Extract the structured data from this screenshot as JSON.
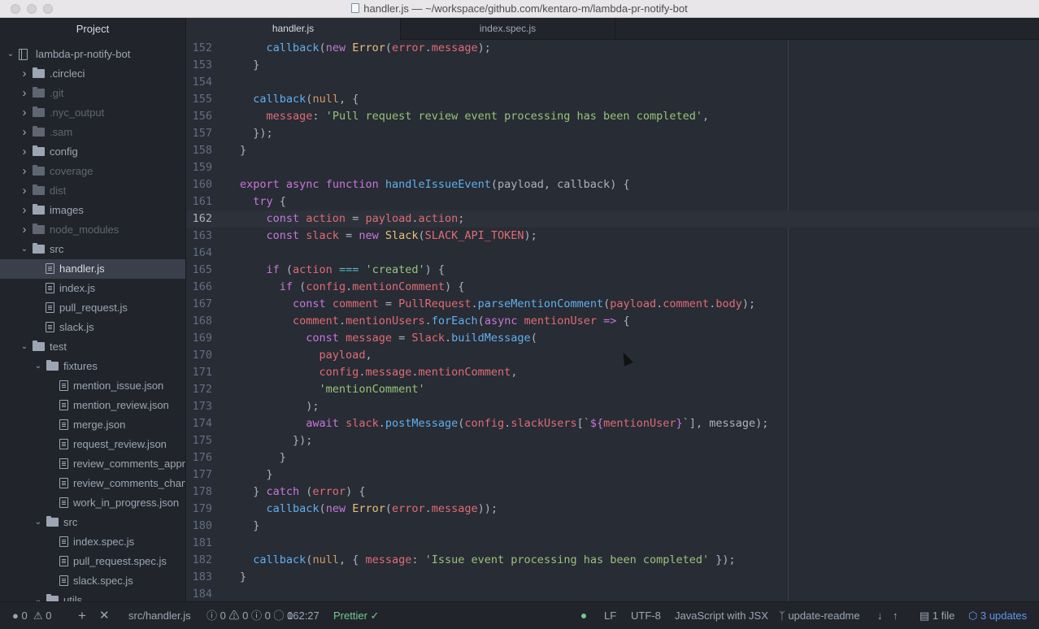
{
  "window": {
    "title": "handler.js — ~/workspace/github.com/kentaro-m/lambda-pr-notify-bot"
  },
  "sidebar": {
    "header": "Project",
    "tree": [
      {
        "label": "lambda-pr-notify-bot",
        "type": "repo",
        "depth": 0,
        "expanded": true,
        "dim": false
      },
      {
        "label": ".circleci",
        "type": "folder",
        "depth": 1,
        "expanded": false,
        "dim": false
      },
      {
        "label": ".git",
        "type": "folder",
        "depth": 1,
        "expanded": false,
        "dim": true
      },
      {
        "label": ".nyc_output",
        "type": "folder",
        "depth": 1,
        "expanded": false,
        "dim": true
      },
      {
        "label": ".sam",
        "type": "folder",
        "depth": 1,
        "expanded": false,
        "dim": true
      },
      {
        "label": "config",
        "type": "folder",
        "depth": 1,
        "expanded": false,
        "dim": false
      },
      {
        "label": "coverage",
        "type": "folder",
        "depth": 1,
        "expanded": false,
        "dim": true
      },
      {
        "label": "dist",
        "type": "folder",
        "depth": 1,
        "expanded": false,
        "dim": true
      },
      {
        "label": "images",
        "type": "folder",
        "depth": 1,
        "expanded": false,
        "dim": false
      },
      {
        "label": "node_modules",
        "type": "folder",
        "depth": 1,
        "expanded": false,
        "dim": true
      },
      {
        "label": "src",
        "type": "folder",
        "depth": 1,
        "expanded": true,
        "dim": false
      },
      {
        "label": "handler.js",
        "type": "file",
        "depth": 2,
        "selected": true
      },
      {
        "label": "index.js",
        "type": "file",
        "depth": 2
      },
      {
        "label": "pull_request.js",
        "type": "file",
        "depth": 2
      },
      {
        "label": "slack.js",
        "type": "file",
        "depth": 2
      },
      {
        "label": "test",
        "type": "folder",
        "depth": 1,
        "expanded": true,
        "dim": false
      },
      {
        "label": "fixtures",
        "type": "folder",
        "depth": 2,
        "expanded": true,
        "dim": false
      },
      {
        "label": "mention_issue.json",
        "type": "file",
        "depth": 3
      },
      {
        "label": "mention_review.json",
        "type": "file",
        "depth": 3
      },
      {
        "label": "merge.json",
        "type": "file",
        "depth": 3
      },
      {
        "label": "request_review.json",
        "type": "file",
        "depth": 3
      },
      {
        "label": "review_comments_appro",
        "type": "file",
        "depth": 3
      },
      {
        "label": "review_comments_chan",
        "type": "file",
        "depth": 3
      },
      {
        "label": "work_in_progress.json",
        "type": "file",
        "depth": 3
      },
      {
        "label": "src",
        "type": "folder",
        "depth": 2,
        "expanded": true,
        "dim": false
      },
      {
        "label": "index.spec.js",
        "type": "file",
        "depth": 3
      },
      {
        "label": "pull_request.spec.js",
        "type": "file",
        "depth": 3
      },
      {
        "label": "slack.spec.js",
        "type": "file",
        "depth": 3
      },
      {
        "label": "utils",
        "type": "folder",
        "depth": 2,
        "expanded": true,
        "dim": false
      }
    ]
  },
  "tabs": [
    {
      "label": "handler.js",
      "active": true
    },
    {
      "label": "index.spec.js",
      "active": false
    }
  ],
  "editor": {
    "cursor_line": 162,
    "lines": [
      {
        "n": "152",
        "t": [
          [
            "    ",
            ""
          ],
          [
            "callback",
            "fn"
          ],
          [
            "(",
            ""
          ],
          [
            "new ",
            "kw"
          ],
          [
            "Error",
            "cls"
          ],
          [
            "(",
            ""
          ],
          [
            "error",
            "var"
          ],
          [
            ".",
            ""
          ],
          [
            "message",
            "var"
          ],
          [
            ");",
            ""
          ]
        ]
      },
      {
        "n": "153",
        "t": [
          [
            "  }",
            ""
          ]
        ]
      },
      {
        "n": "154",
        "t": []
      },
      {
        "n": "155",
        "t": [
          [
            "  ",
            ""
          ],
          [
            "callback",
            "fn"
          ],
          [
            "(",
            ""
          ],
          [
            "null",
            "num"
          ],
          [
            ", {",
            ""
          ]
        ]
      },
      {
        "n": "156",
        "t": [
          [
            "    ",
            ""
          ],
          [
            "message",
            "var"
          ],
          [
            ": ",
            ""
          ],
          [
            "'Pull request review event processing has been completed'",
            "str"
          ],
          [
            ",",
            ""
          ]
        ]
      },
      {
        "n": "157",
        "t": [
          [
            "  });",
            ""
          ]
        ]
      },
      {
        "n": "158",
        "t": [
          [
            "}",
            ""
          ]
        ]
      },
      {
        "n": "159",
        "t": []
      },
      {
        "n": "160",
        "t": [
          [
            "export ",
            "kw"
          ],
          [
            "async ",
            "kw"
          ],
          [
            "function ",
            "kw"
          ],
          [
            "handleIssueEvent",
            "fn"
          ],
          [
            "(payload, callback) {",
            ""
          ]
        ]
      },
      {
        "n": "161",
        "t": [
          [
            "  ",
            ""
          ],
          [
            "try",
            "kw"
          ],
          [
            " {",
            ""
          ]
        ]
      },
      {
        "n": "162",
        "t": [
          [
            "    ",
            ""
          ],
          [
            "const ",
            "kw"
          ],
          [
            "action",
            "var"
          ],
          [
            " = ",
            ""
          ],
          [
            "payload",
            "var"
          ],
          [
            ".",
            ""
          ],
          [
            "action",
            "var"
          ],
          [
            ";",
            ""
          ]
        ]
      },
      {
        "n": "163",
        "t": [
          [
            "    ",
            ""
          ],
          [
            "const ",
            "kw"
          ],
          [
            "slack",
            "var"
          ],
          [
            " = ",
            ""
          ],
          [
            "new ",
            "kw"
          ],
          [
            "Slack",
            "cls"
          ],
          [
            "(",
            ""
          ],
          [
            "SLACK_API_TOKEN",
            "var"
          ],
          [
            ");",
            ""
          ]
        ]
      },
      {
        "n": "164",
        "t": []
      },
      {
        "n": "165",
        "t": [
          [
            "    ",
            ""
          ],
          [
            "if",
            "kw"
          ],
          [
            " (",
            ""
          ],
          [
            "action",
            "var"
          ],
          [
            " ",
            ""
          ],
          [
            "===",
            "op"
          ],
          [
            " ",
            ""
          ],
          [
            "'created'",
            "str"
          ],
          [
            ") {",
            ""
          ]
        ]
      },
      {
        "n": "166",
        "t": [
          [
            "      ",
            ""
          ],
          [
            "if",
            "kw"
          ],
          [
            " (",
            ""
          ],
          [
            "config",
            "var"
          ],
          [
            ".",
            ""
          ],
          [
            "mentionComment",
            "var"
          ],
          [
            ") {",
            ""
          ]
        ]
      },
      {
        "n": "167",
        "t": [
          [
            "        ",
            ""
          ],
          [
            "const ",
            "kw"
          ],
          [
            "comment",
            "var"
          ],
          [
            " = ",
            ""
          ],
          [
            "PullRequest",
            "var"
          ],
          [
            ".",
            ""
          ],
          [
            "parseMentionComment",
            "fn"
          ],
          [
            "(",
            ""
          ],
          [
            "payload",
            "var"
          ],
          [
            ".",
            ""
          ],
          [
            "comment",
            "var"
          ],
          [
            ".",
            ""
          ],
          [
            "body",
            "var"
          ],
          [
            ");",
            ""
          ]
        ]
      },
      {
        "n": "168",
        "t": [
          [
            "        ",
            ""
          ],
          [
            "comment",
            "var"
          ],
          [
            ".",
            ""
          ],
          [
            "mentionUsers",
            "var"
          ],
          [
            ".",
            ""
          ],
          [
            "forEach",
            "fn"
          ],
          [
            "(",
            ""
          ],
          [
            "async ",
            "kw"
          ],
          [
            "mentionUser",
            "var"
          ],
          [
            " ",
            ""
          ],
          [
            "=>",
            "kw"
          ],
          [
            " {",
            ""
          ]
        ]
      },
      {
        "n": "169",
        "t": [
          [
            "          ",
            ""
          ],
          [
            "const ",
            "kw"
          ],
          [
            "message",
            "var"
          ],
          [
            " = ",
            ""
          ],
          [
            "Slack",
            "var"
          ],
          [
            ".",
            ""
          ],
          [
            "buildMessage",
            "fn"
          ],
          [
            "(",
            ""
          ]
        ]
      },
      {
        "n": "170",
        "t": [
          [
            "            ",
            ""
          ],
          [
            "payload",
            "var"
          ],
          [
            ",",
            ""
          ]
        ]
      },
      {
        "n": "171",
        "t": [
          [
            "            ",
            ""
          ],
          [
            "config",
            "var"
          ],
          [
            ".",
            ""
          ],
          [
            "message",
            "var"
          ],
          [
            ".",
            ""
          ],
          [
            "mentionComment",
            "var"
          ],
          [
            ",",
            ""
          ]
        ]
      },
      {
        "n": "172",
        "t": [
          [
            "            ",
            ""
          ],
          [
            "'mentionComment'",
            "str"
          ]
        ]
      },
      {
        "n": "173",
        "t": [
          [
            "          );",
            ""
          ]
        ]
      },
      {
        "n": "174",
        "t": [
          [
            "          ",
            ""
          ],
          [
            "await ",
            "kw"
          ],
          [
            "slack",
            "var"
          ],
          [
            ".",
            ""
          ],
          [
            "postMessage",
            "fn"
          ],
          [
            "(",
            ""
          ],
          [
            "config",
            "var"
          ],
          [
            ".",
            ""
          ],
          [
            "slackUsers",
            "var"
          ],
          [
            "[",
            ""
          ],
          [
            "`",
            "str"
          ],
          [
            "${",
            "kw"
          ],
          [
            "mentionUser",
            "var"
          ],
          [
            "}",
            "kw"
          ],
          [
            "`",
            "str"
          ],
          [
            "], message);",
            ""
          ]
        ]
      },
      {
        "n": "175",
        "t": [
          [
            "        });",
            ""
          ]
        ]
      },
      {
        "n": "176",
        "t": [
          [
            "      }",
            ""
          ]
        ]
      },
      {
        "n": "177",
        "t": [
          [
            "    }",
            ""
          ]
        ]
      },
      {
        "n": "178",
        "t": [
          [
            "  } ",
            ""
          ],
          [
            "catch",
            "kw"
          ],
          [
            " (",
            ""
          ],
          [
            "error",
            "var"
          ],
          [
            ") {",
            ""
          ]
        ]
      },
      {
        "n": "179",
        "t": [
          [
            "    ",
            ""
          ],
          [
            "callback",
            "fn"
          ],
          [
            "(",
            ""
          ],
          [
            "new ",
            "kw"
          ],
          [
            "Error",
            "cls"
          ],
          [
            "(",
            ""
          ],
          [
            "error",
            "var"
          ],
          [
            ".",
            ""
          ],
          [
            "message",
            "var"
          ],
          [
            "));",
            ""
          ]
        ]
      },
      {
        "n": "180",
        "t": [
          [
            "  }",
            ""
          ]
        ]
      },
      {
        "n": "181",
        "t": []
      },
      {
        "n": "182",
        "t": [
          [
            "  ",
            ""
          ],
          [
            "callback",
            "fn"
          ],
          [
            "(",
            ""
          ],
          [
            "null",
            "num"
          ],
          [
            ", { ",
            ""
          ],
          [
            "message",
            "var"
          ],
          [
            ": ",
            ""
          ],
          [
            "'Issue event processing has been completed'",
            "str"
          ],
          [
            " });",
            ""
          ]
        ]
      },
      {
        "n": "183",
        "t": [
          [
            "}",
            ""
          ]
        ]
      },
      {
        "n": "184",
        "t": []
      }
    ]
  },
  "statusbar": {
    "errors": "0",
    "warnings": "0",
    "file_path": "src/handler.js",
    "lint_errors": "0",
    "lint_warnings": "0",
    "lint_info": "0",
    "lint_other": "0",
    "cursor_position": "162:27",
    "formatter": "Prettier ✓",
    "line_ending": "LF",
    "encoding": "UTF-8",
    "grammar": "JavaScript with JSX",
    "branch": "update-readme",
    "files_changed": "1 file",
    "updates": "3 updates",
    "colors": {
      "ok": "#73c990",
      "link": "#6494ed"
    }
  }
}
